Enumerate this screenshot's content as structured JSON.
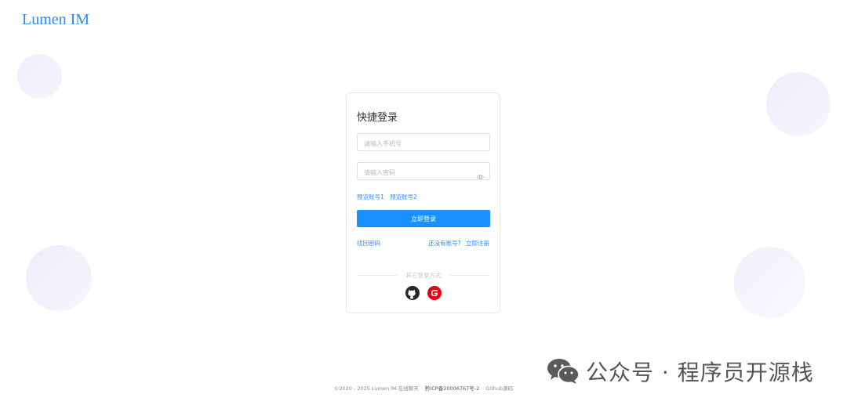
{
  "app": {
    "logo": "Lumen IM"
  },
  "login": {
    "title": "快捷登录",
    "phone_placeholder": "请输入手机号",
    "password_placeholder": "请输入密码",
    "demo_account_1": "预览账号1",
    "demo_account_2": "预览账号2",
    "login_button": "立即登录",
    "forgot_password": "找回密码",
    "no_account_text": "还没有账号?",
    "register_link": "立即注册",
    "other_methods": "其它登录方式",
    "social": [
      {
        "name": "github",
        "icon": "github-icon"
      },
      {
        "name": "gitee",
        "icon": "gitee-icon"
      }
    ]
  },
  "footer": {
    "copyright": "©2020 - 2025 Lumen IM 在线聊天",
    "icp": "黔ICP备20006767号-2",
    "source": "Github源码"
  },
  "watermark": {
    "text": "公众号 · 程序员开源栈",
    "icon": "wechat-icon"
  },
  "colors": {
    "accent": "#2d8cf0",
    "button": "#1890ff",
    "gitee": "#e60012",
    "github": "#24292e"
  }
}
